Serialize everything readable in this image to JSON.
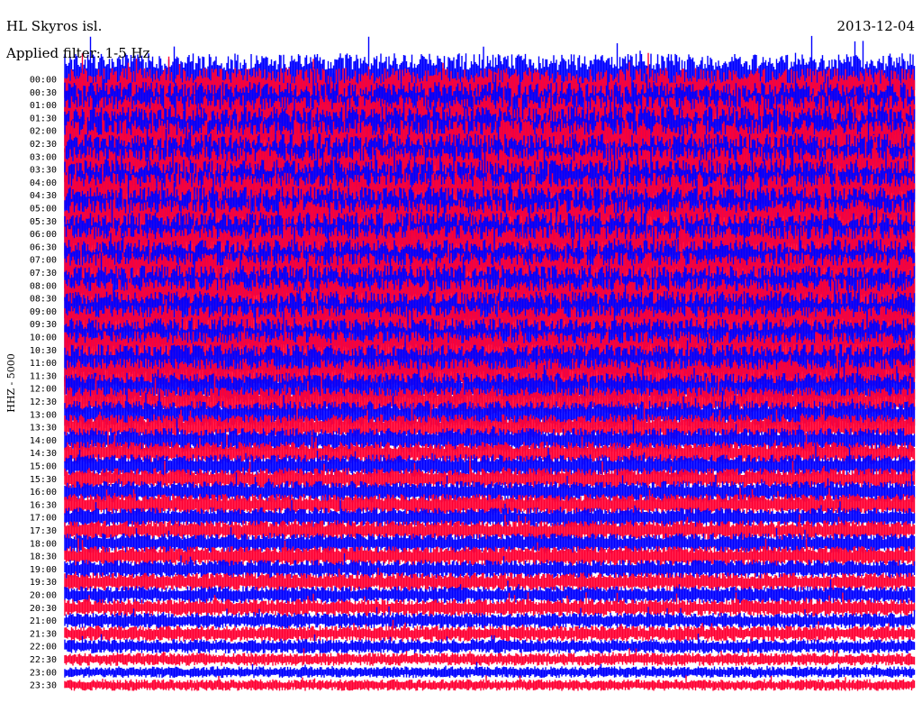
{
  "header": {
    "station": "HL Skyros isl.",
    "date": "2013-12-04",
    "filter_text": "Applied filter: 1-5 Hz"
  },
  "chart_data": {
    "type": "line",
    "title": "HL Skyros isl.",
    "ylabel": "HHZ - 5000",
    "row_labels": [
      "00:00",
      "00:30",
      "01:00",
      "01:30",
      "02:00",
      "02:30",
      "03:00",
      "03:30",
      "04:00",
      "04:30",
      "05:00",
      "05:30",
      "06:00",
      "06:30",
      "07:00",
      "07:30",
      "08:00",
      "08:30",
      "09:00",
      "09:30",
      "10:00",
      "10:30",
      "11:00",
      "11:30",
      "12:00",
      "12:30",
      "13:00",
      "13:30",
      "14:00",
      "14:30",
      "15:00",
      "15:30",
      "16:00",
      "16:30",
      "17:00",
      "17:30",
      "18:00",
      "18:30",
      "19:00",
      "19:30",
      "20:00",
      "20:30",
      "21:00",
      "21:30",
      "22:00",
      "22:30",
      "23:00",
      "23:30"
    ],
    "relative_amplitude": [
      1.8,
      1.7,
      1.6,
      1.6,
      1.7,
      1.7,
      1.6,
      1.6,
      1.6,
      1.6,
      1.5,
      1.5,
      1.5,
      1.5,
      1.4,
      1.4,
      1.4,
      1.4,
      1.4,
      1.3,
      1.3,
      1.3,
      1.3,
      1.2,
      1.1,
      1.0,
      0.95,
      0.9,
      0.85,
      0.8,
      0.8,
      0.75,
      0.75,
      0.75,
      0.7,
      0.7,
      0.7,
      0.7,
      0.65,
      0.65,
      0.6,
      0.6,
      0.55,
      0.55,
      0.5,
      0.45,
      0.4,
      0.4
    ],
    "trace_colors": [
      "#0000ff",
      "#ff0033"
    ],
    "grid": false
  }
}
